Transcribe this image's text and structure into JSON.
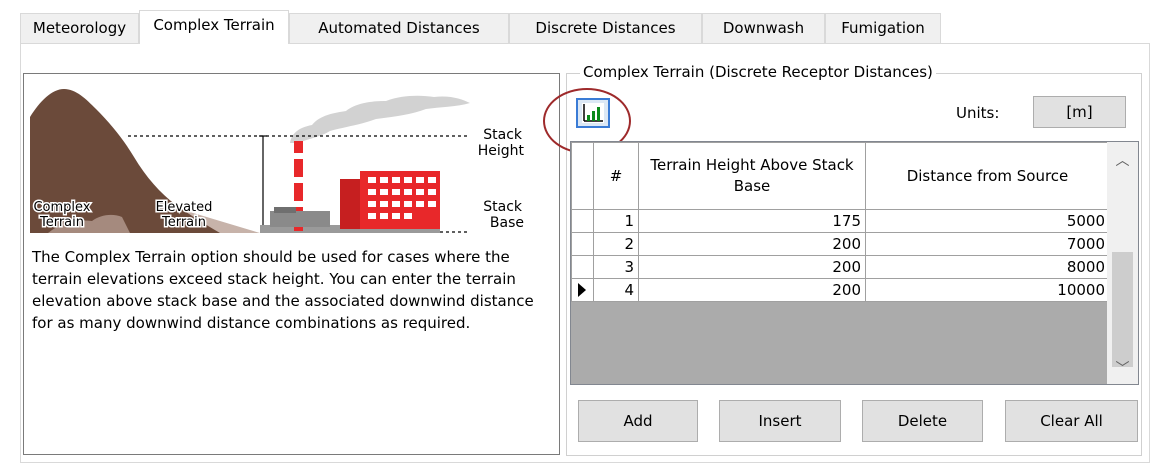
{
  "tabs": [
    {
      "label": "Meteorology",
      "active": false
    },
    {
      "label": "Complex Terrain",
      "active": true
    },
    {
      "label": "Automated Distances",
      "active": false
    },
    {
      "label": "Discrete Distances",
      "active": false
    },
    {
      "label": "Downwash",
      "active": false
    },
    {
      "label": "Fumigation",
      "active": false
    }
  ],
  "illustration": {
    "stack_height": "Stack",
    "stack_height_2": "Height",
    "stack_base": "Stack",
    "stack_base_2": "Base",
    "complex": "Complex",
    "complex_2": "Terrain",
    "elevated": "Elevated",
    "elevated_2": "Terrain"
  },
  "description": "The Complex Terrain option should be used for cases where the terrain elevations exceed stack height. You can enter the terrain elevation above stack base and the associated downwind distance for as many downwind distance combinations as required.",
  "group": {
    "title": "Complex Terrain (Discrete Receptor Distances)",
    "chart_button_icon": "bar-chart-icon",
    "units_label": "Units:",
    "units_value": "[m]"
  },
  "grid": {
    "columns": [
      "#",
      "Terrain Height Above Stack Base",
      "Distance from Source"
    ],
    "rows": [
      {
        "num": "1",
        "terrain": "175",
        "distance": "5000"
      },
      {
        "num": "2",
        "terrain": "200",
        "distance": "7000"
      },
      {
        "num": "3",
        "terrain": "200",
        "distance": "8000"
      },
      {
        "num": "4",
        "terrain": "200",
        "distance": "10000"
      }
    ],
    "current_row": 3
  },
  "buttons": {
    "add": "Add",
    "insert": "Insert",
    "delete": "Delete",
    "clear_all": "Clear All"
  },
  "colors": {
    "terrain_dark": "#6b4a3a",
    "terrain_light": "#c7b3aa",
    "building": "#e8282a",
    "highlight": "#9e2a2b"
  }
}
